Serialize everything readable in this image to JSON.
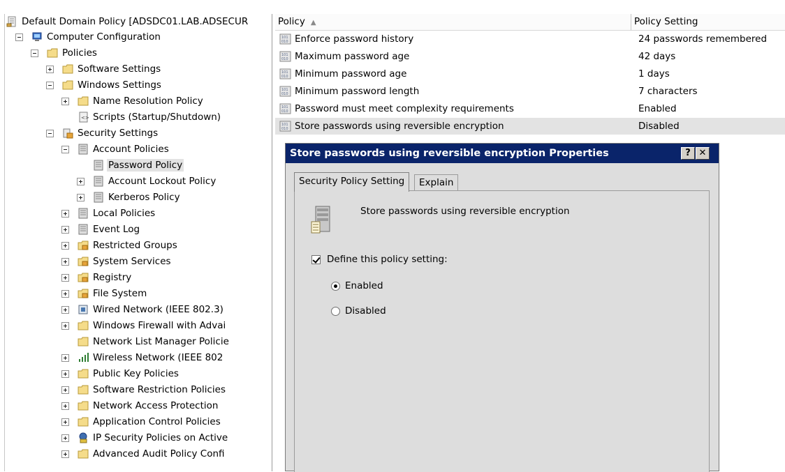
{
  "tree": {
    "root_label": "Default Domain Policy [ADSDC01.LAB.ADSECUR",
    "items": [
      {
        "label": "Computer Configuration",
        "expander": "minus",
        "icon": "computer-icon"
      },
      {
        "label": "Policies",
        "expander": "minus",
        "icon": "folder-icon"
      },
      {
        "label": "Software Settings",
        "expander": "plus",
        "icon": "folder-icon"
      },
      {
        "label": "Windows Settings",
        "expander": "minus",
        "icon": "folder-icon"
      },
      {
        "label": "Name Resolution Policy",
        "expander": "plus",
        "icon": "folder-icon"
      },
      {
        "label": "Scripts (Startup/Shutdown)",
        "expander": "none",
        "icon": "script-icon"
      },
      {
        "label": "Security Settings",
        "expander": "minus",
        "icon": "security-icon"
      },
      {
        "label": "Account Policies",
        "expander": "minus",
        "icon": "policy-icon"
      },
      {
        "label": "Password Policy",
        "expander": "none",
        "icon": "policy-icon"
      },
      {
        "label": "Account Lockout Policy",
        "expander": "plus",
        "icon": "policy-icon"
      },
      {
        "label": "Kerberos Policy",
        "expander": "plus",
        "icon": "policy-icon"
      },
      {
        "label": "Local Policies",
        "expander": "plus",
        "icon": "policy-icon"
      },
      {
        "label": "Event Log",
        "expander": "plus",
        "icon": "policy-icon"
      },
      {
        "label": "Restricted Groups",
        "expander": "plus",
        "icon": "security-folder-icon"
      },
      {
        "label": "System Services",
        "expander": "plus",
        "icon": "security-folder-icon"
      },
      {
        "label": "Registry",
        "expander": "plus",
        "icon": "security-folder-icon"
      },
      {
        "label": "File System",
        "expander": "plus",
        "icon": "security-folder-icon"
      },
      {
        "label": "Wired Network (IEEE 802.3)",
        "expander": "plus",
        "icon": "network-icon"
      },
      {
        "label": "Windows Firewall with Advai",
        "expander": "plus",
        "icon": "folder-icon"
      },
      {
        "label": "Network List Manager Policie",
        "expander": "none",
        "icon": "folder-icon"
      },
      {
        "label": "Wireless Network (IEEE 802",
        "expander": "plus",
        "icon": "wireless-icon"
      },
      {
        "label": "Public Key Policies",
        "expander": "plus",
        "icon": "folder-icon"
      },
      {
        "label": "Software Restriction Policies",
        "expander": "plus",
        "icon": "folder-icon"
      },
      {
        "label": "Network Access Protection",
        "expander": "plus",
        "icon": "folder-icon"
      },
      {
        "label": "Application Control Policies",
        "expander": "plus",
        "icon": "folder-icon"
      },
      {
        "label": "IP Security Policies on Active",
        "expander": "plus",
        "icon": "shield-icon"
      },
      {
        "label": "Advanced Audit Policy Confi",
        "expander": "plus",
        "icon": "folder-icon"
      }
    ]
  },
  "list": {
    "columns": [
      "Policy",
      "Policy Setting"
    ],
    "rows": [
      {
        "name": "Enforce password history",
        "value": "24 passwords remembered"
      },
      {
        "name": "Maximum password age",
        "value": "42 days"
      },
      {
        "name": "Minimum password age",
        "value": "1 days"
      },
      {
        "name": "Minimum password length",
        "value": "7 characters"
      },
      {
        "name": "Password must meet complexity requirements",
        "value": "Enabled"
      },
      {
        "name": "Store passwords using reversible encryption",
        "value": "Disabled"
      }
    ]
  },
  "dialog": {
    "title": "Store passwords using reversible encryption Properties",
    "help_glyph": "?",
    "close_glyph": "✕",
    "tabs": [
      "Security Policy Setting",
      "Explain"
    ],
    "policy_name": "Store passwords using reversible encryption",
    "define_label": "Define this policy setting:",
    "define_checked": true,
    "options": [
      "Enabled",
      "Disabled"
    ],
    "selected_option": "Enabled"
  },
  "colors": {
    "title_bar": "#0a246a",
    "dialog_bg": "#dddddd",
    "selected_row": "#e3e3e3"
  }
}
